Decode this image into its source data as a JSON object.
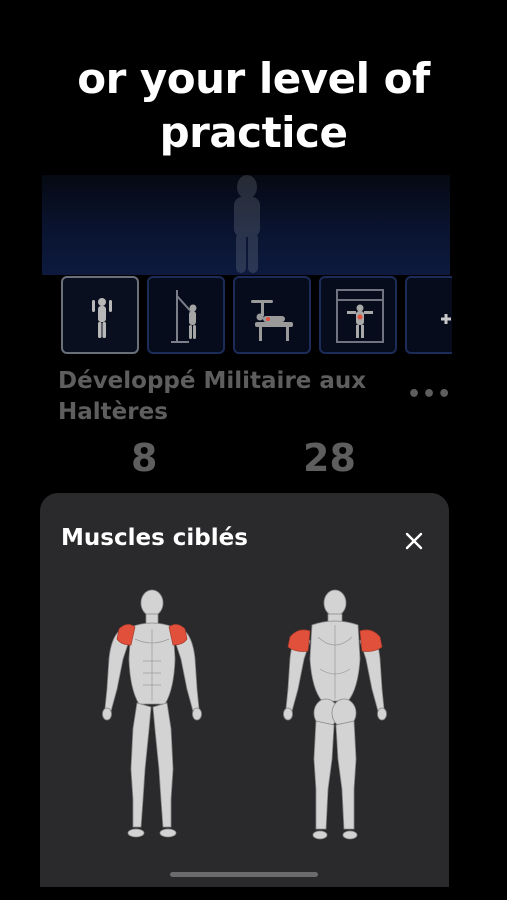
{
  "headline": {
    "line1": "or your level of",
    "line2": "practice"
  },
  "exercise": {
    "title_line1": "Développé Militaire aux",
    "title_line2": "Haltères",
    "more_icon": "more-dots-icon",
    "stats": [
      {
        "value": "8"
      },
      {
        "value": "28"
      }
    ]
  },
  "thumbnails": [
    {
      "name": "thumb-exercise-standing",
      "active": true
    },
    {
      "name": "thumb-exercise-cable",
      "active": false
    },
    {
      "name": "thumb-exercise-bench",
      "active": false
    },
    {
      "name": "thumb-exercise-machine",
      "active": false
    },
    {
      "name": "thumb-add",
      "active": false,
      "label": "+"
    }
  ],
  "sheet": {
    "title": "Muscles ciblés",
    "close_icon": "close-icon",
    "highlight_color": "#e0503a",
    "body_color": "#d6d6d6"
  }
}
